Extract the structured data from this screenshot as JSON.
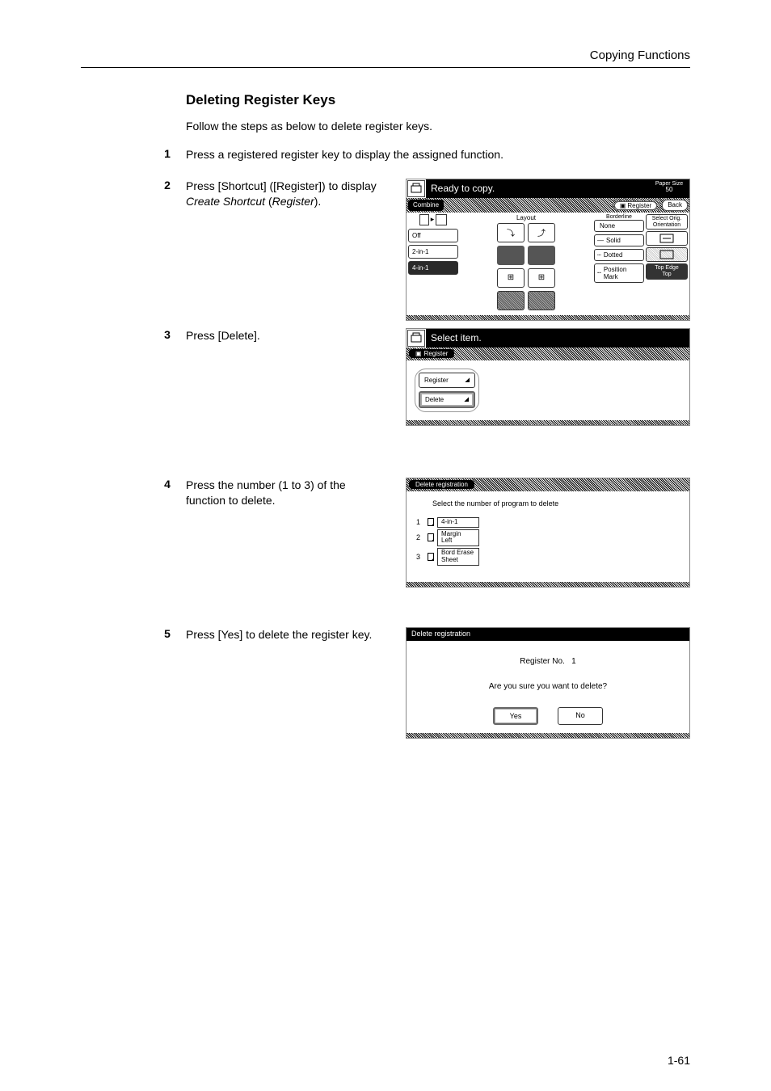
{
  "header": {
    "section": "Copying Functions"
  },
  "section_title": "Deleting Register Keys",
  "intro": "Follow the steps as below to delete register keys.",
  "steps": {
    "s1": {
      "num": "1",
      "text": "Press a registered register key to display the assigned function."
    },
    "s2": {
      "num": "2",
      "text_a": "Press [Shortcut] ([Register]) to display ",
      "text_b": "Create Shortcut",
      "text_c": " (",
      "text_d": "Register",
      "text_e": ")."
    },
    "s3": {
      "num": "3",
      "text": "Press [Delete]."
    },
    "s4": {
      "num": "4",
      "text": "Press the number (1 to 3) of the function to delete."
    },
    "s5": {
      "num": "5",
      "text": "Press [Yes] to delete the register key."
    }
  },
  "screen1": {
    "title": "Ready to copy.",
    "paper_size": "Paper Size",
    "count": "50",
    "combine": "Combine",
    "register": "Register",
    "back": "Back",
    "layout": "Layout",
    "borderline": "Borderline",
    "off": "Off",
    "two_in_one": "2-in-1",
    "four_in_one": "4-in-1",
    "none": "None",
    "solid": "Solid",
    "dotted": "Dotted",
    "position": "Position\nMark",
    "select_orig": "Select Orig.\nOrientation",
    "top_edge": "Top Edge\nTop"
  },
  "screen2": {
    "title": "Select item.",
    "tab": "Register",
    "btn_register": "Register",
    "btn_delete": "Delete"
  },
  "screen3": {
    "tab": "Delete registration",
    "sub": "Select the number of program to delete",
    "items": [
      {
        "n": "1",
        "label": "4-in-1"
      },
      {
        "n": "2",
        "label": "Margin\nLeft"
      },
      {
        "n": "3",
        "label": "Bord Erase\nSheet"
      }
    ]
  },
  "screen4": {
    "tab": "Delete registration",
    "reg_no_label": "Register No.",
    "reg_no_value": "1",
    "confirm": "Are you sure you want to delete?",
    "yes": "Yes",
    "no": "No"
  },
  "page_num": "1-61"
}
